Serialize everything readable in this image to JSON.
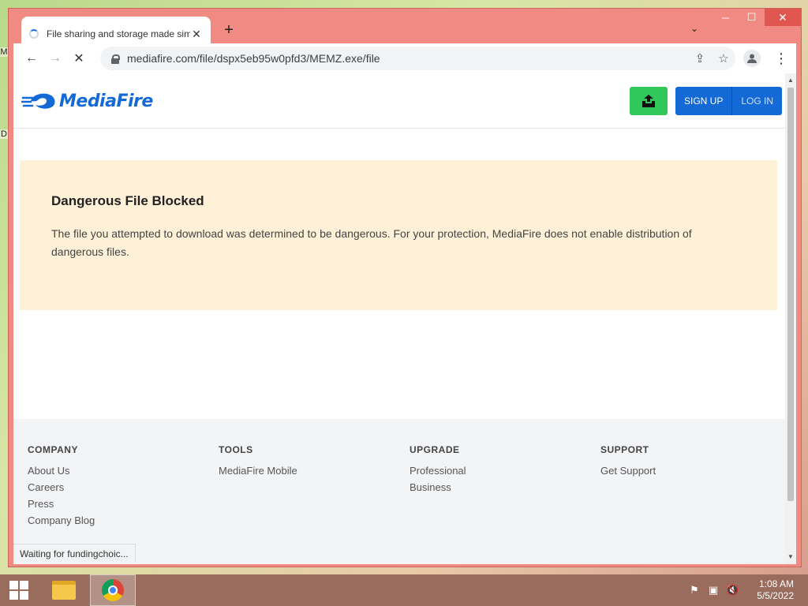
{
  "desktop": {
    "label_m": "M",
    "label_d": "D"
  },
  "window": {
    "minimize": "─",
    "maximize": "☐",
    "close": "✕"
  },
  "tab": {
    "title": "File sharing and storage made simple",
    "close": "✕",
    "new_tab": "+",
    "search_tabs": "⌄"
  },
  "toolbar": {
    "back": "←",
    "forward": "→",
    "stop": "✕",
    "url": "mediafire.com/file/dspx5eb95w0pfd3/MEMZ.exe/file",
    "share": "⇪",
    "bookmark": "☆",
    "menu": "⋮"
  },
  "header": {
    "logo_text": "MediaFire",
    "signup": "SIGN UP",
    "login": "LOG IN"
  },
  "alert": {
    "title": "Dangerous File Blocked",
    "body": "The file you attempted to download was determined to be dangerous. For your protection, MediaFire does not enable distribution of dangerous files."
  },
  "footer": {
    "company": {
      "title": "COMPANY",
      "links": [
        "About Us",
        "Careers",
        "Press",
        "Company Blog"
      ]
    },
    "tools": {
      "title": "TOOLS",
      "links": [
        "MediaFire Mobile"
      ]
    },
    "upgrade": {
      "title": "UPGRADE",
      "links": [
        "Professional",
        "Business"
      ]
    },
    "support": {
      "title": "SUPPORT",
      "links": [
        "Get Support"
      ]
    }
  },
  "status": "Waiting for fundingchoic...",
  "taskbar": {
    "time": "1:08 AM",
    "date": "5/5/2022"
  },
  "colors": {
    "brand_blue": "#1369d6",
    "download_green": "#32c75b",
    "alert_bg": "#fef1d7",
    "window_frame": "#f08a83"
  }
}
